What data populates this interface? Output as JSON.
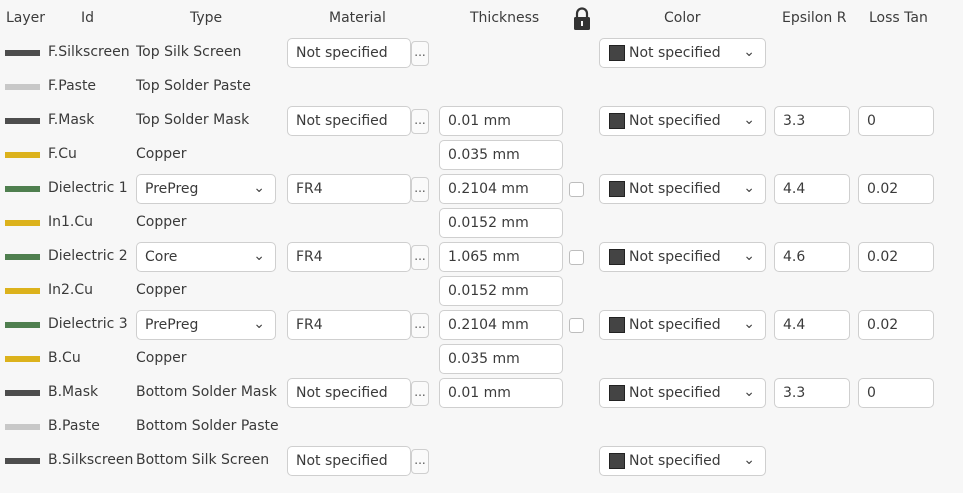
{
  "headers": {
    "layer": "Layer",
    "id": "Id",
    "type": "Type",
    "material": "Material",
    "thickness": "Thickness",
    "color": "Color",
    "epsilon": "Epsilon R",
    "loss_tan": "Loss Tan"
  },
  "colors": {
    "silk": "#4d4d4d",
    "paste": "#c8c8c8",
    "mask": "#4d4d4d",
    "copper": "#dcb21c",
    "dielectric": "#4f7f4f"
  },
  "dots_label": "...",
  "rows": [
    {
      "id": "F.Silkscreen",
      "type": "Top Silk Screen",
      "material": "Not specified",
      "thickness": "",
      "color": "Not specified",
      "epsilon": "",
      "loss": ""
    },
    {
      "id": "F.Paste",
      "type": "Top Solder Paste",
      "material": "",
      "thickness": "",
      "color": "",
      "epsilon": "",
      "loss": ""
    },
    {
      "id": "F.Mask",
      "type": "Top Solder Mask",
      "material": "Not specified",
      "thickness": "0.01 mm",
      "color": "Not specified",
      "epsilon": "3.3",
      "loss": "0"
    },
    {
      "id": "F.Cu",
      "type": "Copper",
      "material": "",
      "thickness": "0.035 mm",
      "color": "",
      "epsilon": "",
      "loss": ""
    },
    {
      "id": "Dielectric 1",
      "type": "PrePreg",
      "material": "FR4",
      "thickness": "0.2104 mm",
      "color": "Not specified",
      "epsilon": "4.4",
      "loss": "0.02"
    },
    {
      "id": "In1.Cu",
      "type": "Copper",
      "material": "",
      "thickness": "0.0152 mm",
      "color": "",
      "epsilon": "",
      "loss": ""
    },
    {
      "id": "Dielectric 2",
      "type": "Core",
      "material": "FR4",
      "thickness": "1.065 mm",
      "color": "Not specified",
      "epsilon": "4.6",
      "loss": "0.02"
    },
    {
      "id": "In2.Cu",
      "type": "Copper",
      "material": "",
      "thickness": "0.0152 mm",
      "color": "",
      "epsilon": "",
      "loss": ""
    },
    {
      "id": "Dielectric 3",
      "type": "PrePreg",
      "material": "FR4",
      "thickness": "0.2104 mm",
      "color": "Not specified",
      "epsilon": "4.4",
      "loss": "0.02"
    },
    {
      "id": "B.Cu",
      "type": "Copper",
      "material": "",
      "thickness": "0.035 mm",
      "color": "",
      "epsilon": "",
      "loss": ""
    },
    {
      "id": "B.Mask",
      "type": "Bottom Solder Mask",
      "material": "Not specified",
      "thickness": "0.01 mm",
      "color": "Not specified",
      "epsilon": "3.3",
      "loss": "0"
    },
    {
      "id": "B.Paste",
      "type": "Bottom Solder Paste",
      "material": "",
      "thickness": "",
      "color": "",
      "epsilon": "",
      "loss": ""
    },
    {
      "id": "B.Silkscreen",
      "type": "Bottom Silk Screen",
      "material": "Not specified",
      "thickness": "",
      "color": "Not specified",
      "epsilon": "",
      "loss": ""
    }
  ]
}
